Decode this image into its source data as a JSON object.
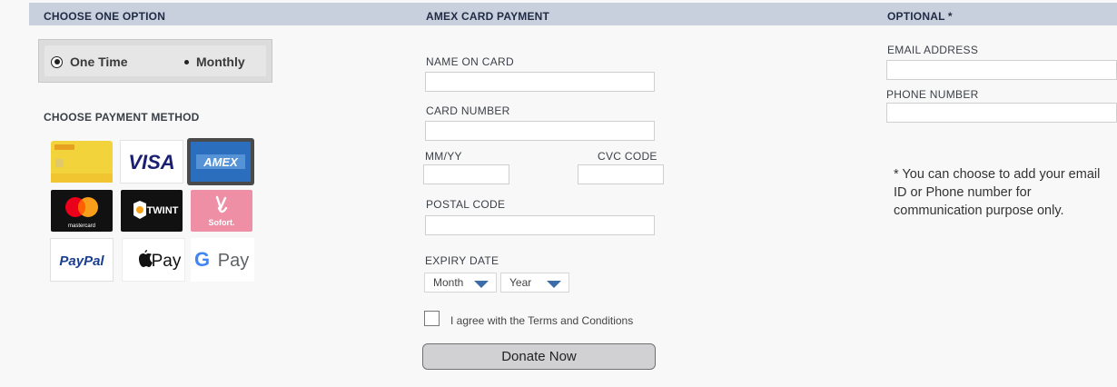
{
  "columns": {
    "choose_option": "CHOOSE ONE OPTION",
    "amex_payment": "AMEX CARD PAYMENT",
    "optional": "OPTIONAL *"
  },
  "frequency": {
    "options": [
      {
        "label": "One Time",
        "selected": true
      },
      {
        "label": "Monthly",
        "selected": false
      }
    ]
  },
  "payment": {
    "heading": "CHOOSE PAYMENT METHOD",
    "methods": [
      {
        "name": "postfinance-card-icon",
        "selected": false
      },
      {
        "name": "visa-icon",
        "label": "VISA",
        "selected": false
      },
      {
        "name": "amex-icon",
        "label": "AMEX",
        "selected": true
      },
      {
        "name": "mastercard-icon",
        "label": "mastercard",
        "selected": false
      },
      {
        "name": "twint-icon",
        "label": "TWINT",
        "selected": false
      },
      {
        "name": "sofort-icon",
        "label": "Sofort.",
        "selected": false
      },
      {
        "name": "paypal-icon",
        "label": "PayPal",
        "selected": false
      },
      {
        "name": "apple-pay-icon",
        "label": "Pay",
        "selected": false
      },
      {
        "name": "google-pay-icon",
        "label": "Pay",
        "selected": false
      }
    ]
  },
  "card_form": {
    "name_label": "NAME ON CARD",
    "name_value": "",
    "number_label": "CARD NUMBER",
    "number_value": "",
    "mmyy_label": "MM/YY",
    "mmyy_value": "",
    "cvc_label": "CVC CODE",
    "cvc_value": "",
    "postal_label": "POSTAL CODE",
    "postal_value": "",
    "expiry_label": "EXPIRY DATE",
    "month_selected": "Month",
    "year_selected": "Year",
    "terms_label": "I agree with the Terms and Conditions",
    "terms_checked": false,
    "submit_label": "Donate Now"
  },
  "optional": {
    "email_label": "EMAIL ADDRESS",
    "email_value": "",
    "phone_label": "PHONE NUMBER",
    "phone_value": "",
    "note": "* You can choose to add your email ID or Phone number for communication purpose only."
  },
  "colors": {
    "header_bar": "#c9d0dd",
    "amex_blue": "#2a6ebd",
    "dropdown_caret": "#3b6ea8",
    "button_bg": "#d1d1d3"
  }
}
